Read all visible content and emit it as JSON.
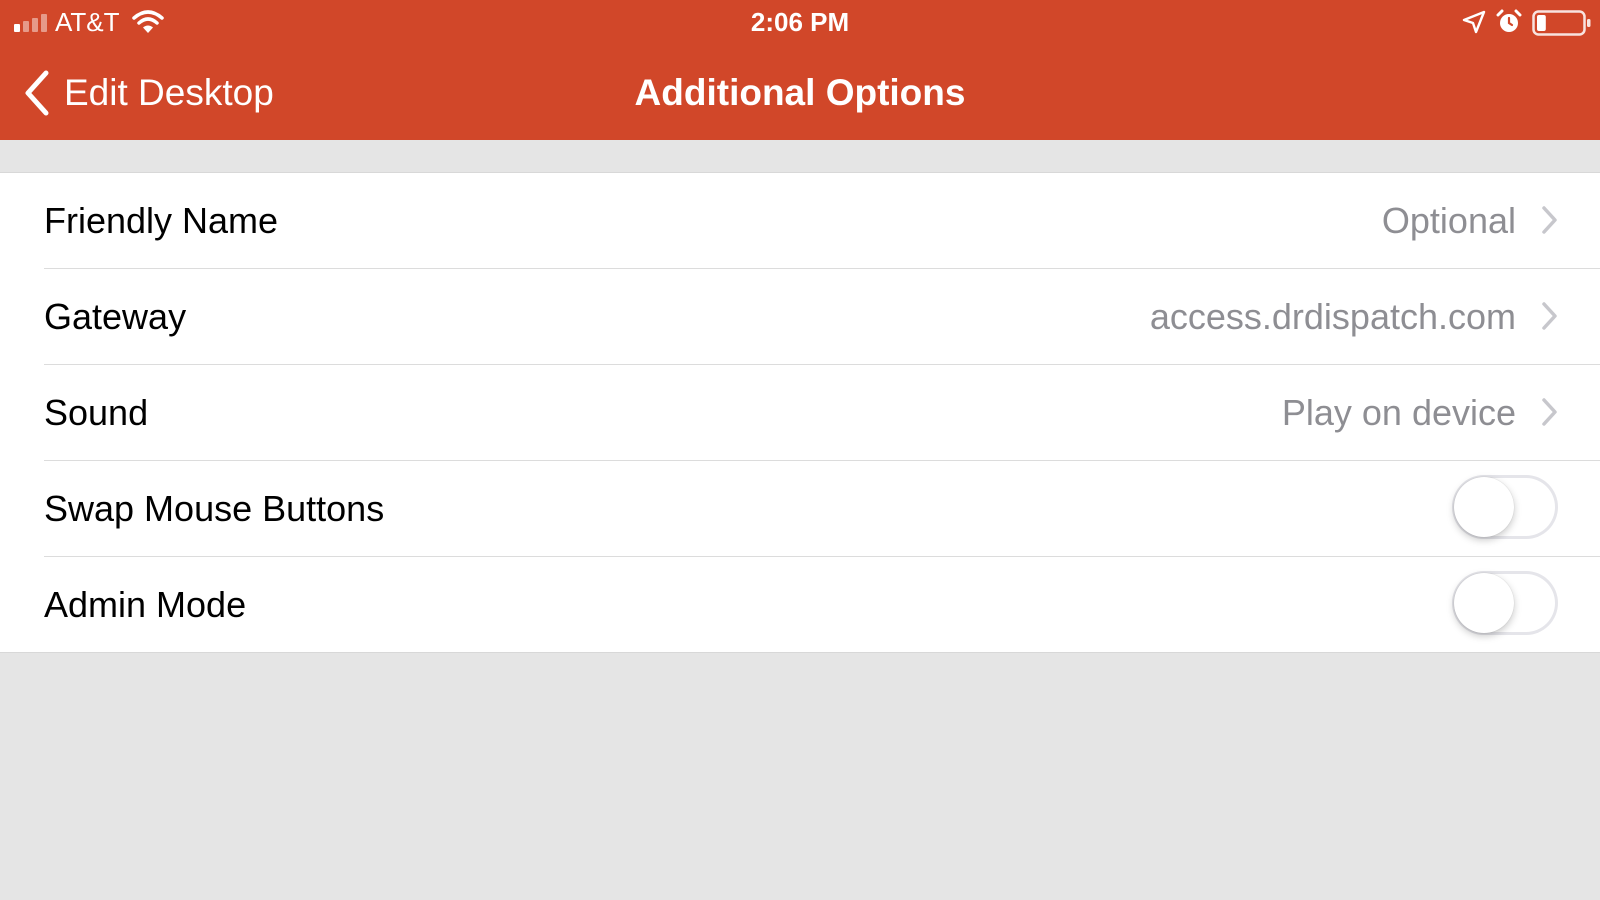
{
  "status_bar": {
    "carrier": "AT&T",
    "time": "2:06 PM",
    "signal_bars": 4,
    "signal_bars_active": 1,
    "battery_level": 0.2
  },
  "nav": {
    "back_label": "Edit Desktop",
    "title": "Additional Options"
  },
  "rows": [
    {
      "label": "Friendly Name",
      "value": "Optional",
      "type": "disclosure"
    },
    {
      "label": "Gateway",
      "value": "access.drdispatch.com",
      "type": "disclosure"
    },
    {
      "label": "Sound",
      "value": "Play on device",
      "type": "disclosure"
    },
    {
      "label": "Swap Mouse Buttons",
      "type": "toggle",
      "on": false
    },
    {
      "label": "Admin Mode",
      "type": "toggle",
      "on": false
    }
  ],
  "icons": {
    "back": "chevron-left-icon",
    "disclosure": "chevron-right-icon",
    "wifi": "wifi-icon",
    "location": "location-arrow-icon",
    "alarm": "alarm-clock-icon",
    "battery": "battery-icon",
    "signal": "signal-bars-icon"
  },
  "colors": {
    "header_background": "#d14729",
    "header_text": "#ffffff",
    "page_background": "#e5e5e5",
    "row_background": "#ffffff",
    "row_label": "#000000",
    "row_value": "#8e8e93",
    "chevron": "#c7c7cc",
    "separator": "#dcdcdc",
    "toggle_off_border": "#e5e5ea"
  }
}
